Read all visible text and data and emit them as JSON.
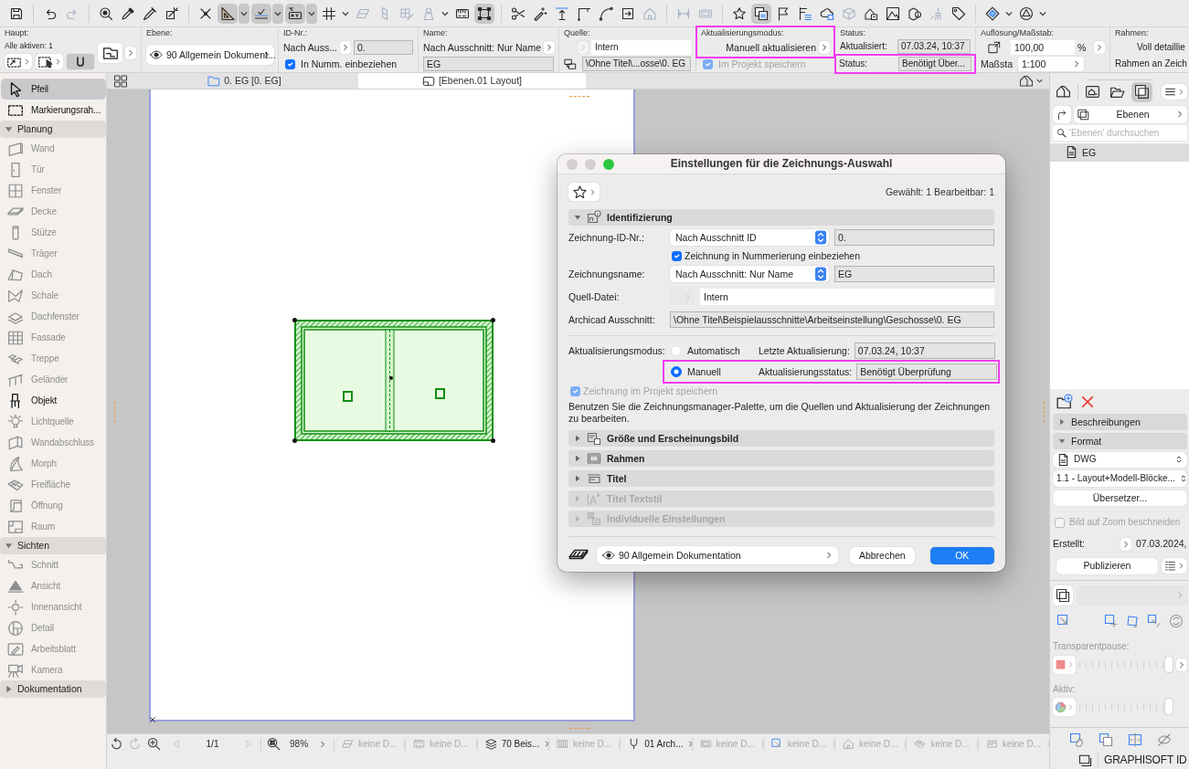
{
  "toolbar": [
    [
      {
        "selected": false,
        "disabled": false,
        "menu": false
      }
    ],
    [
      {
        "selected": false,
        "disabled": false,
        "menu": false
      },
      {
        "selected": false,
        "disabled": true,
        "menu": false
      }
    ],
    [
      {
        "selected": false,
        "disabled": false,
        "menu": false
      },
      {
        "selected": false,
        "disabled": false,
        "menu": false
      },
      {
        "selected": false,
        "disabled": false,
        "menu": false
      },
      {
        "selected": false,
        "disabled": false,
        "menu": false
      }
    ],
    [
      {
        "selected": false,
        "disabled": false,
        "menu": false
      },
      {
        "selected": true,
        "disabled": false,
        "menu": true
      },
      {
        "selected": true,
        "disabled": false,
        "menu": true
      },
      {
        "selected": true,
        "disabled": false,
        "menu": true
      },
      {
        "selected": false,
        "disabled": false,
        "menu": true
      },
      {
        "selected": false,
        "disabled": true,
        "menu": false
      },
      {
        "selected": false,
        "disabled": true,
        "menu": false
      },
      {
        "selected": false,
        "disabled": true,
        "menu": false
      },
      {
        "selected": false,
        "disabled": true,
        "menu": true
      },
      {
        "selected": false,
        "disabled": false,
        "menu": false
      },
      {
        "selected": true,
        "disabled": false,
        "menu": false
      }
    ],
    [
      {
        "selected": false,
        "disabled": false,
        "menu": false
      },
      {
        "selected": false,
        "disabled": false,
        "menu": false
      },
      {
        "selected": false,
        "disabled": false,
        "menu": false
      },
      {
        "selected": false,
        "disabled": false,
        "menu": false
      },
      {
        "selected": false,
        "disabled": false,
        "menu": false
      },
      {
        "selected": false,
        "disabled": false,
        "menu": false
      },
      {
        "selected": false,
        "disabled": true,
        "menu": false
      }
    ],
    [
      {
        "selected": false,
        "disabled": true,
        "menu": false
      },
      {
        "selected": false,
        "disabled": true,
        "menu": false
      }
    ],
    [
      {
        "selected": false,
        "disabled": false,
        "menu": false
      },
      {
        "selected": true,
        "disabled": false,
        "menu": false
      },
      {
        "selected": false,
        "disabled": false,
        "menu": false
      },
      {
        "selected": false,
        "disabled": false,
        "menu": false
      },
      {
        "selected": false,
        "disabled": false,
        "menu": false
      },
      {
        "selected": false,
        "disabled": true,
        "menu": false
      },
      {
        "selected": false,
        "disabled": false,
        "menu": false
      },
      {
        "selected": false,
        "disabled": false,
        "menu": false
      },
      {
        "selected": false,
        "disabled": false,
        "menu": false
      },
      {
        "selected": false,
        "disabled": true,
        "menu": false
      },
      {
        "selected": false,
        "disabled": false,
        "menu": false
      }
    ],
    [
      {
        "selected": false,
        "disabled": false,
        "menu": true
      },
      {
        "selected": false,
        "disabled": false,
        "menu": true
      }
    ]
  ],
  "info_box": {
    "main": {
      "label": "Haupt:",
      "summary": "Alle aktiven: 1",
      "buttons": [
        {
          "selected": false
        },
        {
          "selected": false
        },
        {
          "selected": true
        }
      ]
    },
    "layer": {
      "label": "Ebene:",
      "value": "90 Allgemein Dokument..."
    },
    "id": {
      "label": "ID-Nr.:",
      "mode": "Nach Auss...",
      "value": "0.",
      "include": {
        "label": "In Numm. einbeziehen",
        "checked": true
      }
    },
    "name": {
      "label": "Name:",
      "mode": "Nach Ausschnitt: Nur Name",
      "value": "EG"
    },
    "source": {
      "label": "Quelle:",
      "value": "Intern",
      "path": "\\Ohne Titel\\...osse\\0. EG"
    },
    "update_mode": {
      "label": "Aktualisierungsmodus:",
      "value": "Manuell aktualisieren",
      "highlighted": true,
      "store": {
        "label": "Im Projekt speichern",
        "checked": true,
        "disabled": true
      }
    },
    "status": {
      "label": "Status:",
      "rows": [
        {
          "label": "Aktualisiert:",
          "value": "07.03.24, 10:37",
          "highlighted": false
        },
        {
          "label": "Status:",
          "value": "Benötigt Über...",
          "highlighted": true
        }
      ]
    },
    "scale": {
      "label": "Auflösung/Maßstab:",
      "resolution": "100,00",
      "unit": "%",
      "scale_label": "Maßsta",
      "scale": "1:100"
    },
    "frame": {
      "label": "Rahmen:",
      "lines": [
        "Voll detaillie",
        "Rahmen an Zeich"
      ]
    }
  },
  "view_tabs": [
    {
      "label": "0. EG [0. EG]",
      "selected": false
    },
    {
      "label": "[Ebenen.01 Layout]",
      "selected": true
    }
  ],
  "toolbox": {
    "items": [
      {
        "label": "Pfeil",
        "selected": true,
        "disabled": false
      },
      {
        "label": "Markierungsrah...",
        "selected": false,
        "disabled": false
      }
    ],
    "sections": [
      {
        "label": "Planung",
        "expanded": true,
        "items": [
          {
            "label": "Wand",
            "selected": false,
            "disabled": true
          },
          {
            "label": "Tür",
            "selected": false,
            "disabled": true
          },
          {
            "label": "Fenster",
            "selected": false,
            "disabled": true
          },
          {
            "label": "Decke",
            "selected": false,
            "disabled": true
          },
          {
            "label": "Stütze",
            "selected": false,
            "disabled": true
          },
          {
            "label": "Träger",
            "selected": false,
            "disabled": true
          },
          {
            "label": "Dach",
            "selected": false,
            "disabled": true
          },
          {
            "label": "Schale",
            "selected": false,
            "disabled": true
          },
          {
            "label": "Dachfenster",
            "selected": false,
            "disabled": true
          },
          {
            "label": "Fassade",
            "selected": false,
            "disabled": true
          },
          {
            "label": "Treppe",
            "selected": false,
            "disabled": true
          },
          {
            "label": "Geländer",
            "selected": false,
            "disabled": true
          },
          {
            "label": "Objekt",
            "selected": false,
            "disabled": false
          },
          {
            "label": "Lichtquelle",
            "selected": false,
            "disabled": true
          },
          {
            "label": "Wandabschluss",
            "selected": false,
            "disabled": true
          },
          {
            "label": "Morph",
            "selected": false,
            "disabled": true
          },
          {
            "label": "Freifläche",
            "selected": false,
            "disabled": true
          },
          {
            "label": "Öffnung",
            "selected": false,
            "disabled": true
          },
          {
            "label": "Raum",
            "selected": false,
            "disabled": true
          }
        ]
      },
      {
        "label": "Sichten",
        "expanded": true,
        "items": [
          {
            "label": "Schnitt",
            "selected": false,
            "disabled": true
          },
          {
            "label": "Ansicht",
            "selected": false,
            "disabled": true
          },
          {
            "label": "Innenansicht",
            "selected": false,
            "disabled": true
          },
          {
            "label": "Detail",
            "selected": false,
            "disabled": true
          },
          {
            "label": "Arbeitsblatt",
            "selected": false,
            "disabled": true
          },
          {
            "label": "Kamera",
            "selected": false,
            "disabled": true
          }
        ]
      },
      {
        "label": "Dokumentation",
        "expanded": false
      }
    ]
  },
  "canvas": {
    "drawing": {
      "selected": true
    }
  },
  "dialog": {
    "title": "Einstellungen für die Zeichnungs-Auswahl",
    "selection_info": "Gewählt: 1 Bearbeitbar: 1",
    "sections": [
      {
        "label": "Identifizierung",
        "expanded": true,
        "disabled": false
      },
      {
        "label": "Größe und Erscheinungsbild",
        "expanded": false,
        "disabled": false
      },
      {
        "label": "Rahmen",
        "expanded": false,
        "disabled": false
      },
      {
        "label": "Titel",
        "expanded": false,
        "disabled": false
      },
      {
        "label": "Titel Textstil",
        "expanded": false,
        "disabled": true
      },
      {
        "label": "Individuelle Einstellungen",
        "expanded": false,
        "disabled": true
      }
    ],
    "identification": {
      "id": {
        "label": "Zeichnung-ID-Nr.:",
        "mode": "Nach Ausschnitt ID",
        "value": "0."
      },
      "include": {
        "label": "Zeichnung in Nummerierung einbeziehen",
        "checked": true
      },
      "name": {
        "label": "Zeichnungsname:",
        "mode": "Nach Ausschnitt: Nur Name",
        "value": "EG"
      },
      "source": {
        "label": "Quell-Datei:",
        "value": "Intern",
        "button_disabled": true
      },
      "view": {
        "label": "Archicad Ausschnitt:",
        "value": "\\Ohne Titel\\Beispielausschnitte\\Arbeitseinstellung\\Geschosse\\0. EG"
      },
      "update": {
        "label": "Aktualisierungsmodus:",
        "options": [
          {
            "label": "Automatisch",
            "selected": false,
            "info_label": "Letzte Aktualisierung:",
            "info_value": "07.03.24, 10:37",
            "highlighted": false
          },
          {
            "label": "Manuell",
            "selected": true,
            "info_label": "Aktualisierungsstatus:",
            "info_value": "Benötigt Überprüfung",
            "highlighted": true
          }
        ]
      },
      "store": {
        "label": "Zeichnung im Projekt speichern",
        "checked": true,
        "disabled": true
      },
      "note": "Benutzen Sie die Zeichnungsmanager-Palette, um die Quellen und Aktualisierung der Zeichnungen zu bearbeiten."
    },
    "layer": "90 Allgemein Dokumentation",
    "buttons": [
      {
        "label": "Abbrechen",
        "primary": false
      },
      {
        "label": "OK",
        "primary": true
      }
    ]
  },
  "navigator": {
    "tabs": [
      {
        "selected": false
      },
      {
        "selected": false
      },
      {
        "selected": false
      },
      {
        "selected": true
      }
    ],
    "source": "Ebenen",
    "search": {
      "placeholder": "'Ebenen' durchsuchen"
    },
    "items": [
      {
        "label": "EG",
        "selected": true
      }
    ],
    "sections": [
      {
        "label": "Beschreibungen",
        "expanded": false
      },
      {
        "label": "Format",
        "expanded": true
      }
    ],
    "format": {
      "type": "DWG",
      "translator": "1.1 - Layout+Modell-Blöcke...",
      "translator_button": "Übersetzer...",
      "crop": {
        "label": "Bild auf Zoom beschneiden",
        "checked": false,
        "disabled": true
      },
      "created_label": "Erstellt:",
      "created": "07.03.2024,",
      "publish": "Publizieren"
    },
    "sliders": [
      {
        "label": "Transparentpause:",
        "level": 1
      },
      {
        "label": "Aktiv:",
        "level": 1
      }
    ]
  },
  "status_bar": {
    "history": [
      {
        "disabled": false
      },
      {
        "disabled": true
      }
    ],
    "page": "1/1",
    "zoom": "98%",
    "items": [
      {
        "label": "keine D...",
        "disabled": true
      },
      {
        "label": "keine D...",
        "disabled": true
      },
      {
        "label": "70 Beis...",
        "disabled": false
      },
      {
        "label": "keine D...",
        "disabled": true
      },
      {
        "label": "01 Arch...",
        "disabled": false
      },
      {
        "label": "keine D...",
        "disabled": true
      },
      {
        "label": "keine D...",
        "disabled": true
      },
      {
        "label": "keine D...",
        "disabled": true
      },
      {
        "label": "keine D...",
        "disabled": true
      },
      {
        "label": "keine D...",
        "disabled": true
      }
    ]
  },
  "footer": {
    "label": "**GRAPHISOFT** ID"
  }
}
